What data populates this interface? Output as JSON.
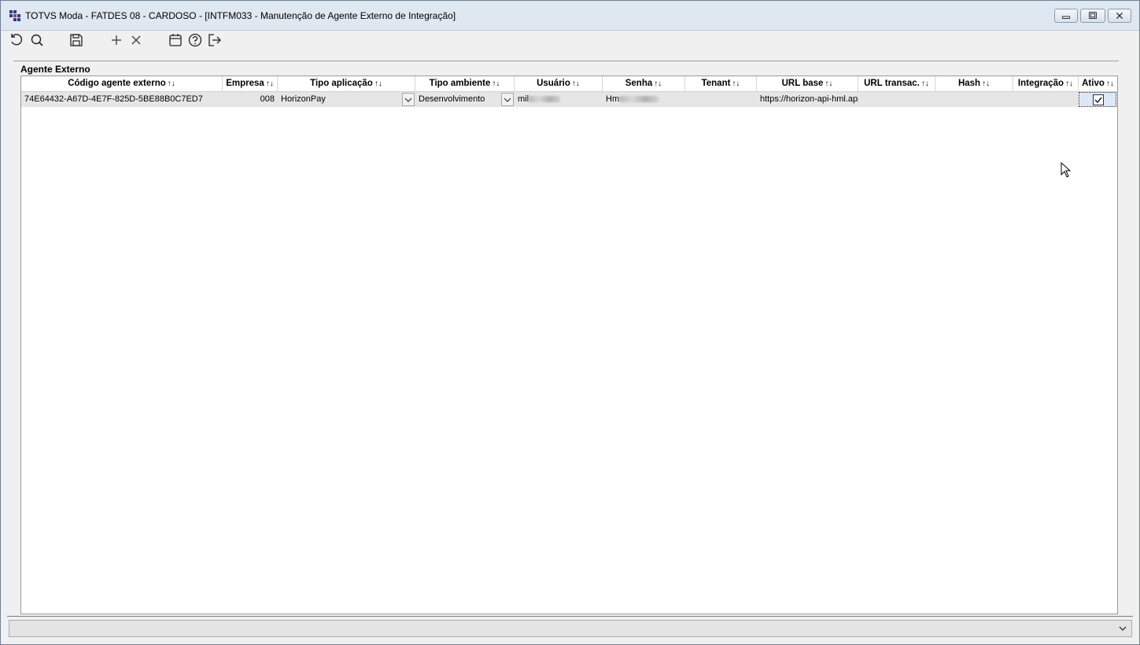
{
  "window": {
    "title": "TOTVS Moda - FATDES 08 - CARDOSO - [INTFM033 - Manutenção de Agente Externo de Integração]"
  },
  "toolbar": {
    "icons": [
      "refresh-icon",
      "search-icon",
      "save-icon",
      "add-icon",
      "delete-icon",
      "calendar-icon",
      "help-icon",
      "exit-icon"
    ]
  },
  "group": {
    "title": "Agente Externo"
  },
  "grid": {
    "sort_glyph": "↑↓",
    "columns": [
      "Código agente externo",
      "Empresa",
      "Tipo aplicação",
      "Tipo ambiente",
      "Usuário",
      "Senha",
      "Tenant",
      "URL base",
      "URL transac.",
      "Hash",
      "Integração",
      "Ativo"
    ],
    "rows": [
      {
        "codigo": "74E64432-A67D-4E7F-825D-5BE88B0C7ED7",
        "empresa": "008",
        "tipo_aplicacao": "HorizonPay",
        "tipo_ambiente": "Desenvolvimento",
        "usuario_visible": "mil",
        "senha_visible": "Hm",
        "tenant": "",
        "url_base": "https://horizon-api-hml.app",
        "url_transac": "",
        "hash": "",
        "integracao": "",
        "ativo": true
      }
    ]
  },
  "colors": {
    "titlebar_bg": "#dfe7f1",
    "row_bg": "#e6e6e6",
    "selected_cell_bg": "#dde8f5"
  }
}
